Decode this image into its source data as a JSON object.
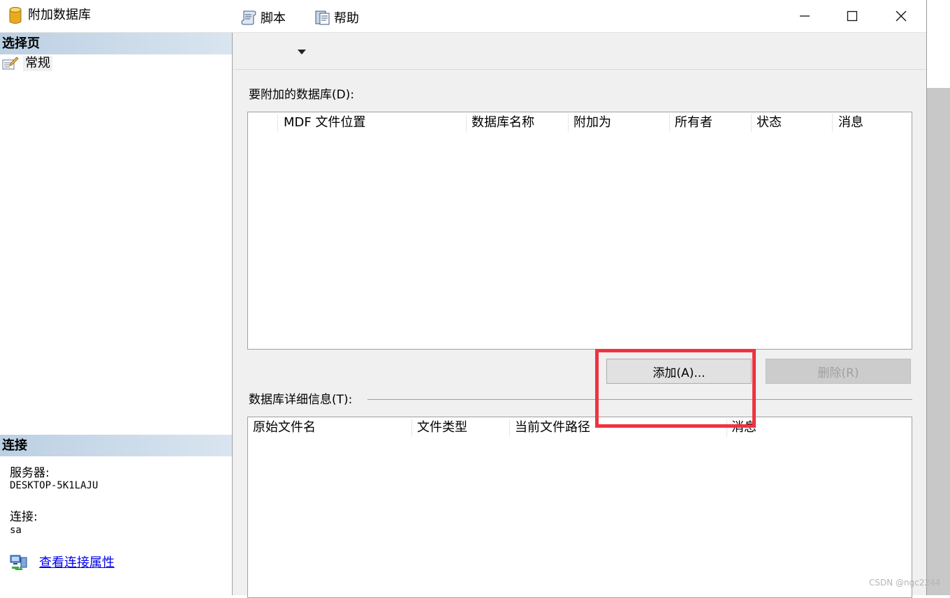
{
  "window": {
    "title": "附加数据库",
    "controls": {
      "minimize": "minimize-icon",
      "maximize": "maximize-icon",
      "close": "close-icon"
    }
  },
  "left_panel": {
    "select_page_header": "选择页",
    "pages": [
      {
        "label": "常规",
        "icon": "general-page-icon"
      }
    ],
    "connection_header": "连接",
    "server_label": "服务器:",
    "server_value": "DESKTOP-5K1LAJU",
    "connection_label": "连接:",
    "connection_value": "sa",
    "view_props_link": "查看连接属性"
  },
  "toolbar": {
    "script_label": "脚本",
    "help_label": "帮助"
  },
  "attach_section": {
    "label": "要附加的数据库(D):",
    "columns": [
      "MDF 文件位置",
      "数据库名称",
      "附加为",
      "所有者",
      "状态",
      "消息"
    ],
    "rows": []
  },
  "buttons": {
    "add": "添加(A)...",
    "delete": "删除(R)"
  },
  "details_section": {
    "label": "数据库详细信息(T):",
    "columns": [
      "原始文件名",
      "文件类型",
      "当前文件路径",
      "消息"
    ],
    "rows": []
  },
  "watermark": "CSDN @ngc2244",
  "colors": {
    "highlight": "#ef3340",
    "section_header": "#bcd0e3",
    "link": "#0000ee"
  }
}
